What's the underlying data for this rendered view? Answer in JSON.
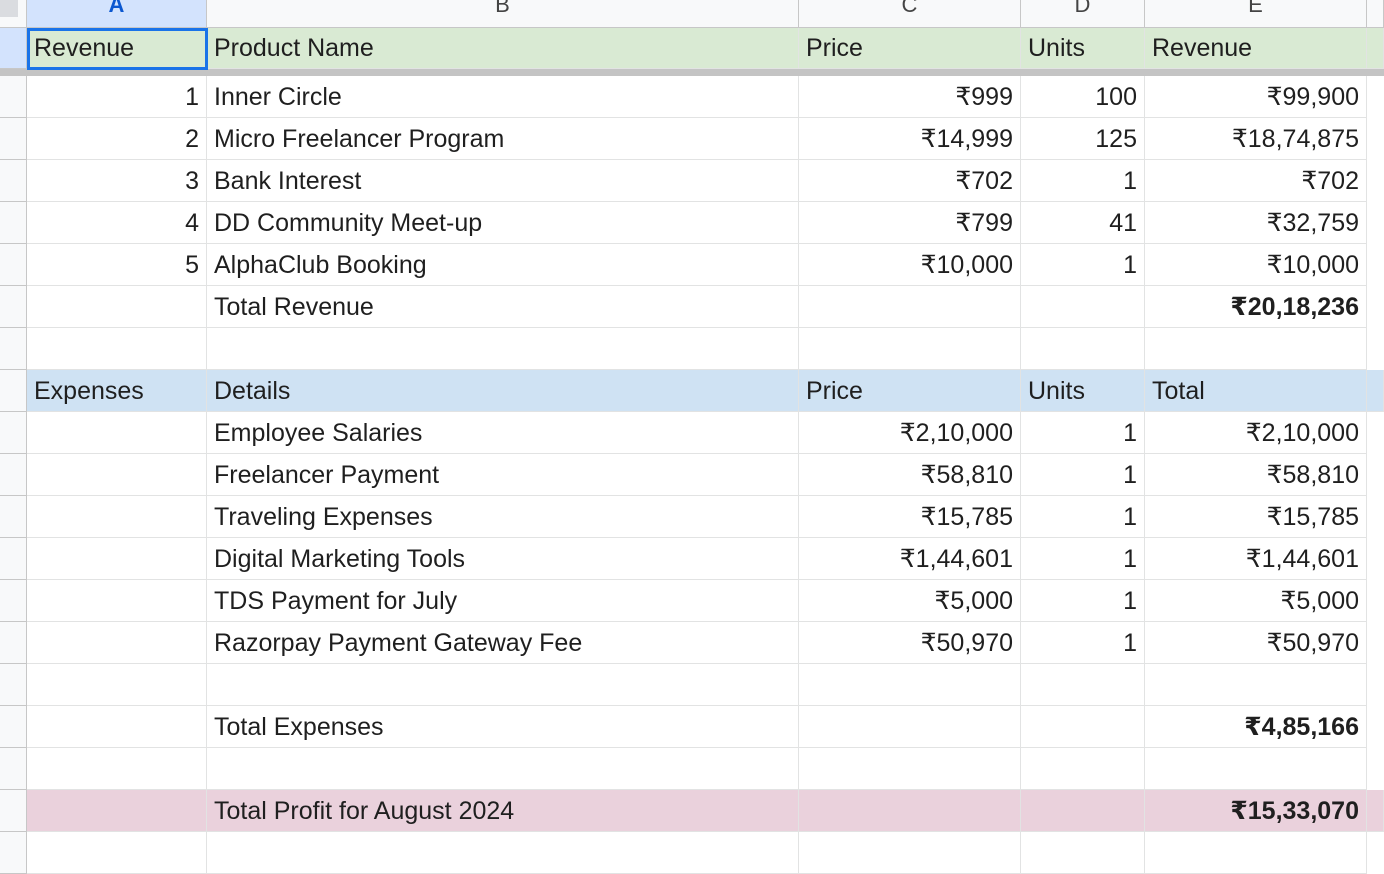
{
  "columns": [
    "A",
    "B",
    "C",
    "D",
    "E"
  ],
  "colors": {
    "revenue_header": "#d9ead3",
    "expenses_header": "#cfe2f3",
    "profit_row": "#ead1dc",
    "selection": "#1a73e8"
  },
  "revenue_table": {
    "headers": {
      "a": "Revenue",
      "b": "Product Name",
      "c": "Price",
      "d": "Units",
      "e": "Revenue"
    },
    "rows": [
      {
        "no": "1",
        "name": "Inner Circle",
        "price": "₹999",
        "units": "100",
        "revenue": "₹99,900"
      },
      {
        "no": "2",
        "name": "Micro Freelancer Program",
        "price": "₹14,999",
        "units": "125",
        "revenue": "₹18,74,875"
      },
      {
        "no": "3",
        "name": "Bank Interest",
        "price": "₹702",
        "units": "1",
        "revenue": "₹702"
      },
      {
        "no": "4",
        "name": "DD Community Meet-up",
        "price": "₹799",
        "units": "41",
        "revenue": "₹32,759"
      },
      {
        "no": "5",
        "name": "AlphaClub Booking",
        "price": "₹10,000",
        "units": "1",
        "revenue": "₹10,000"
      }
    ],
    "total_label": "Total Revenue",
    "total_value": "₹20,18,236"
  },
  "expenses_table": {
    "headers": {
      "a": "Expenses",
      "b": "Details",
      "c": "Price",
      "d": "Units",
      "e": "Total"
    },
    "rows": [
      {
        "name": "Employee Salaries",
        "price": "₹2,10,000",
        "units": "1",
        "total": "₹2,10,000"
      },
      {
        "name": "Freelancer Payment",
        "price": "₹58,810",
        "units": "1",
        "total": "₹58,810"
      },
      {
        "name": "Traveling Expenses",
        "price": "₹15,785",
        "units": "1",
        "total": "₹15,785"
      },
      {
        "name": "Digital Marketing Tools",
        "price": "₹1,44,601",
        "units": "1",
        "total": "₹1,44,601"
      },
      {
        "name": "TDS Payment for July",
        "price": "₹5,000",
        "units": "1",
        "total": "₹5,000"
      },
      {
        "name": "Razorpay Payment Gateway Fee",
        "price": "₹50,970",
        "units": "1",
        "total": "₹50,970"
      }
    ],
    "total_label": "Total Expenses",
    "total_value": "₹4,85,166"
  },
  "profit": {
    "label": "Total Profit  for August 2024",
    "value": "₹15,33,070"
  }
}
